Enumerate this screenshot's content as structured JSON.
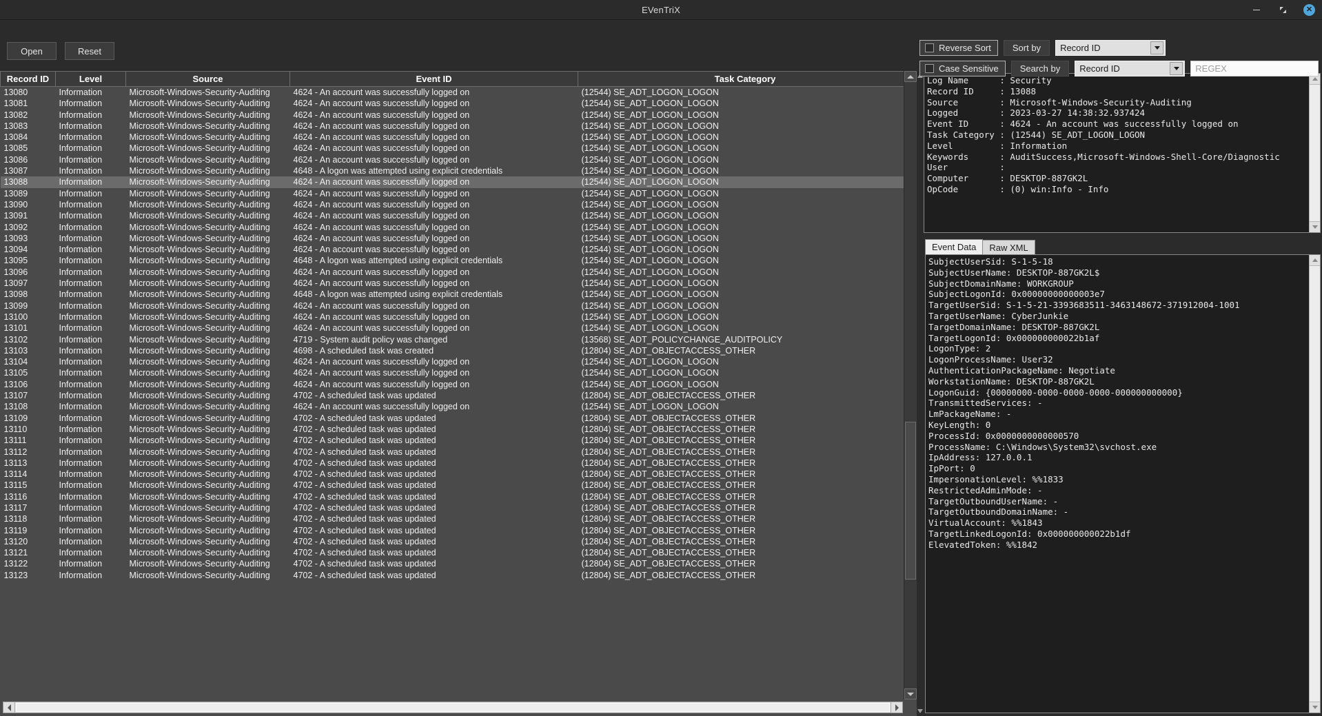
{
  "window": {
    "title": "EVenTriX",
    "minimize_label": "–",
    "maximize_label": "⤡",
    "close_label": "✕"
  },
  "toolbar": {
    "open_label": "Open",
    "reset_label": "Reset",
    "reverse_sort_label": "Reverse Sort",
    "reverse_sort_checked": false,
    "case_sensitive_label": "Case Sensitive",
    "case_sensitive_checked": false,
    "sort_by_label": "Sort by",
    "sort_by_value": "Record ID",
    "search_by_label": "Search by",
    "search_by_value": "Record ID",
    "regex_value": "",
    "regex_placeholder": "REGEX"
  },
  "table": {
    "columns": [
      "Record ID",
      "Level",
      "Source",
      "Event ID",
      "Task Category"
    ],
    "selected_record_id": "13088",
    "rows": [
      [
        "13080",
        "Information",
        "Microsoft-Windows-Security-Auditing",
        "4624 - An account was successfully logged on",
        "(12544) SE_ADT_LOGON_LOGON"
      ],
      [
        "13081",
        "Information",
        "Microsoft-Windows-Security-Auditing",
        "4624 - An account was successfully logged on",
        "(12544) SE_ADT_LOGON_LOGON"
      ],
      [
        "13082",
        "Information",
        "Microsoft-Windows-Security-Auditing",
        "4624 - An account was successfully logged on",
        "(12544) SE_ADT_LOGON_LOGON"
      ],
      [
        "13083",
        "Information",
        "Microsoft-Windows-Security-Auditing",
        "4624 - An account was successfully logged on",
        "(12544) SE_ADT_LOGON_LOGON"
      ],
      [
        "13084",
        "Information",
        "Microsoft-Windows-Security-Auditing",
        "4624 - An account was successfully logged on",
        "(12544) SE_ADT_LOGON_LOGON"
      ],
      [
        "13085",
        "Information",
        "Microsoft-Windows-Security-Auditing",
        "4624 - An account was successfully logged on",
        "(12544) SE_ADT_LOGON_LOGON"
      ],
      [
        "13086",
        "Information",
        "Microsoft-Windows-Security-Auditing",
        "4624 - An account was successfully logged on",
        "(12544) SE_ADT_LOGON_LOGON"
      ],
      [
        "13087",
        "Information",
        "Microsoft-Windows-Security-Auditing",
        "4648 - A logon was attempted using explicit credentials",
        "(12544) SE_ADT_LOGON_LOGON"
      ],
      [
        "13088",
        "Information",
        "Microsoft-Windows-Security-Auditing",
        "4624 - An account was successfully logged on",
        "(12544) SE_ADT_LOGON_LOGON"
      ],
      [
        "13089",
        "Information",
        "Microsoft-Windows-Security-Auditing",
        "4624 - An account was successfully logged on",
        "(12544) SE_ADT_LOGON_LOGON"
      ],
      [
        "13090",
        "Information",
        "Microsoft-Windows-Security-Auditing",
        "4624 - An account was successfully logged on",
        "(12544) SE_ADT_LOGON_LOGON"
      ],
      [
        "13091",
        "Information",
        "Microsoft-Windows-Security-Auditing",
        "4624 - An account was successfully logged on",
        "(12544) SE_ADT_LOGON_LOGON"
      ],
      [
        "13092",
        "Information",
        "Microsoft-Windows-Security-Auditing",
        "4624 - An account was successfully logged on",
        "(12544) SE_ADT_LOGON_LOGON"
      ],
      [
        "13093",
        "Information",
        "Microsoft-Windows-Security-Auditing",
        "4624 - An account was successfully logged on",
        "(12544) SE_ADT_LOGON_LOGON"
      ],
      [
        "13094",
        "Information",
        "Microsoft-Windows-Security-Auditing",
        "4624 - An account was successfully logged on",
        "(12544) SE_ADT_LOGON_LOGON"
      ],
      [
        "13095",
        "Information",
        "Microsoft-Windows-Security-Auditing",
        "4648 - A logon was attempted using explicit credentials",
        "(12544) SE_ADT_LOGON_LOGON"
      ],
      [
        "13096",
        "Information",
        "Microsoft-Windows-Security-Auditing",
        "4624 - An account was successfully logged on",
        "(12544) SE_ADT_LOGON_LOGON"
      ],
      [
        "13097",
        "Information",
        "Microsoft-Windows-Security-Auditing",
        "4624 - An account was successfully logged on",
        "(12544) SE_ADT_LOGON_LOGON"
      ],
      [
        "13098",
        "Information",
        "Microsoft-Windows-Security-Auditing",
        "4648 - A logon was attempted using explicit credentials",
        "(12544) SE_ADT_LOGON_LOGON"
      ],
      [
        "13099",
        "Information",
        "Microsoft-Windows-Security-Auditing",
        "4624 - An account was successfully logged on",
        "(12544) SE_ADT_LOGON_LOGON"
      ],
      [
        "13100",
        "Information",
        "Microsoft-Windows-Security-Auditing",
        "4624 - An account was successfully logged on",
        "(12544) SE_ADT_LOGON_LOGON"
      ],
      [
        "13101",
        "Information",
        "Microsoft-Windows-Security-Auditing",
        "4624 - An account was successfully logged on",
        "(12544) SE_ADT_LOGON_LOGON"
      ],
      [
        "13102",
        "Information",
        "Microsoft-Windows-Security-Auditing",
        "4719 - System audit policy was changed",
        "(13568) SE_ADT_POLICYCHANGE_AUDITPOLICY"
      ],
      [
        "13103",
        "Information",
        "Microsoft-Windows-Security-Auditing",
        "4698 - A scheduled task was created",
        "(12804) SE_ADT_OBJECTACCESS_OTHER"
      ],
      [
        "13104",
        "Information",
        "Microsoft-Windows-Security-Auditing",
        "4624 - An account was successfully logged on",
        "(12544) SE_ADT_LOGON_LOGON"
      ],
      [
        "13105",
        "Information",
        "Microsoft-Windows-Security-Auditing",
        "4624 - An account was successfully logged on",
        "(12544) SE_ADT_LOGON_LOGON"
      ],
      [
        "13106",
        "Information",
        "Microsoft-Windows-Security-Auditing",
        "4624 - An account was successfully logged on",
        "(12544) SE_ADT_LOGON_LOGON"
      ],
      [
        "13107",
        "Information",
        "Microsoft-Windows-Security-Auditing",
        "4702 - A scheduled task was updated",
        "(12804) SE_ADT_OBJECTACCESS_OTHER"
      ],
      [
        "13108",
        "Information",
        "Microsoft-Windows-Security-Auditing",
        "4624 - An account was successfully logged on",
        "(12544) SE_ADT_LOGON_LOGON"
      ],
      [
        "13109",
        "Information",
        "Microsoft-Windows-Security-Auditing",
        "4702 - A scheduled task was updated",
        "(12804) SE_ADT_OBJECTACCESS_OTHER"
      ],
      [
        "13110",
        "Information",
        "Microsoft-Windows-Security-Auditing",
        "4702 - A scheduled task was updated",
        "(12804) SE_ADT_OBJECTACCESS_OTHER"
      ],
      [
        "13111",
        "Information",
        "Microsoft-Windows-Security-Auditing",
        "4702 - A scheduled task was updated",
        "(12804) SE_ADT_OBJECTACCESS_OTHER"
      ],
      [
        "13112",
        "Information",
        "Microsoft-Windows-Security-Auditing",
        "4702 - A scheduled task was updated",
        "(12804) SE_ADT_OBJECTACCESS_OTHER"
      ],
      [
        "13113",
        "Information",
        "Microsoft-Windows-Security-Auditing",
        "4702 - A scheduled task was updated",
        "(12804) SE_ADT_OBJECTACCESS_OTHER"
      ],
      [
        "13114",
        "Information",
        "Microsoft-Windows-Security-Auditing",
        "4702 - A scheduled task was updated",
        "(12804) SE_ADT_OBJECTACCESS_OTHER"
      ],
      [
        "13115",
        "Information",
        "Microsoft-Windows-Security-Auditing",
        "4702 - A scheduled task was updated",
        "(12804) SE_ADT_OBJECTACCESS_OTHER"
      ],
      [
        "13116",
        "Information",
        "Microsoft-Windows-Security-Auditing",
        "4702 - A scheduled task was updated",
        "(12804) SE_ADT_OBJECTACCESS_OTHER"
      ],
      [
        "13117",
        "Information",
        "Microsoft-Windows-Security-Auditing",
        "4702 - A scheduled task was updated",
        "(12804) SE_ADT_OBJECTACCESS_OTHER"
      ],
      [
        "13118",
        "Information",
        "Microsoft-Windows-Security-Auditing",
        "4702 - A scheduled task was updated",
        "(12804) SE_ADT_OBJECTACCESS_OTHER"
      ],
      [
        "13119",
        "Information",
        "Microsoft-Windows-Security-Auditing",
        "4702 - A scheduled task was updated",
        "(12804) SE_ADT_OBJECTACCESS_OTHER"
      ],
      [
        "13120",
        "Information",
        "Microsoft-Windows-Security-Auditing",
        "4702 - A scheduled task was updated",
        "(12804) SE_ADT_OBJECTACCESS_OTHER"
      ],
      [
        "13121",
        "Information",
        "Microsoft-Windows-Security-Auditing",
        "4702 - A scheduled task was updated",
        "(12804) SE_ADT_OBJECTACCESS_OTHER"
      ],
      [
        "13122",
        "Information",
        "Microsoft-Windows-Security-Auditing",
        "4702 - A scheduled task was updated",
        "(12804) SE_ADT_OBJECTACCESS_OTHER"
      ],
      [
        "13123",
        "Information",
        "Microsoft-Windows-Security-Auditing",
        "4702 - A scheduled task was updated",
        "(12804) SE_ADT_OBJECTACCESS_OTHER"
      ]
    ]
  },
  "detail": {
    "summary": "Log Name      : Security\nRecord ID     : 13088\nSource        : Microsoft-Windows-Security-Auditing\nLogged        : 2023-03-27 14:38:32.937424\nEvent ID      : 4624 - An account was successfully logged on\nTask Category : (12544) SE_ADT_LOGON_LOGON\nLevel         : Information\nKeywords      : AuditSuccess,Microsoft-Windows-Shell-Core/Diagnostic\nUser          :\nComputer      : DESKTOP-887GK2L\nOpCode        : (0) win:Info - Info",
    "tabs": [
      {
        "label": "Event Data",
        "active": true
      },
      {
        "label": "Raw XML",
        "active": false
      }
    ],
    "event_data": "SubjectUserSid: S-1-5-18\nSubjectUserName: DESKTOP-887GK2L$\nSubjectDomainName: WORKGROUP\nSubjectLogonId: 0x00000000000003e7\nTargetUserSid: S-1-5-21-3393683511-3463148672-371912004-1001\nTargetUserName: CyberJunkie\nTargetDomainName: DESKTOP-887GK2L\nTargetLogonId: 0x000000000022b1af\nLogonType: 2\nLogonProcessName: User32\nAuthenticationPackageName: Negotiate\nWorkstationName: DESKTOP-887GK2L\nLogonGuid: {00000000-0000-0000-0000-000000000000}\nTransmittedServices: -\nLmPackageName: -\nKeyLength: 0\nProcessId: 0x0000000000000570\nProcessName: C:\\Windows\\System32\\svchost.exe\nIpAddress: 127.0.0.1\nIpPort: 0\nImpersonationLevel: %%1833\nRestrictedAdminMode: -\nTargetOutboundUserName: -\nTargetOutboundDomainName: -\nVirtualAccount: %%1843\nTargetLinkedLogonId: 0x000000000022b1df\nElevatedToken: %%1842"
  },
  "colors": {
    "accent": "#4ea6dc",
    "window_bg": "#2b2b2b",
    "table_bg": "#4a4a4a",
    "selected_row": "#6b6b6b",
    "detail_bg": "#1e1e1e"
  }
}
